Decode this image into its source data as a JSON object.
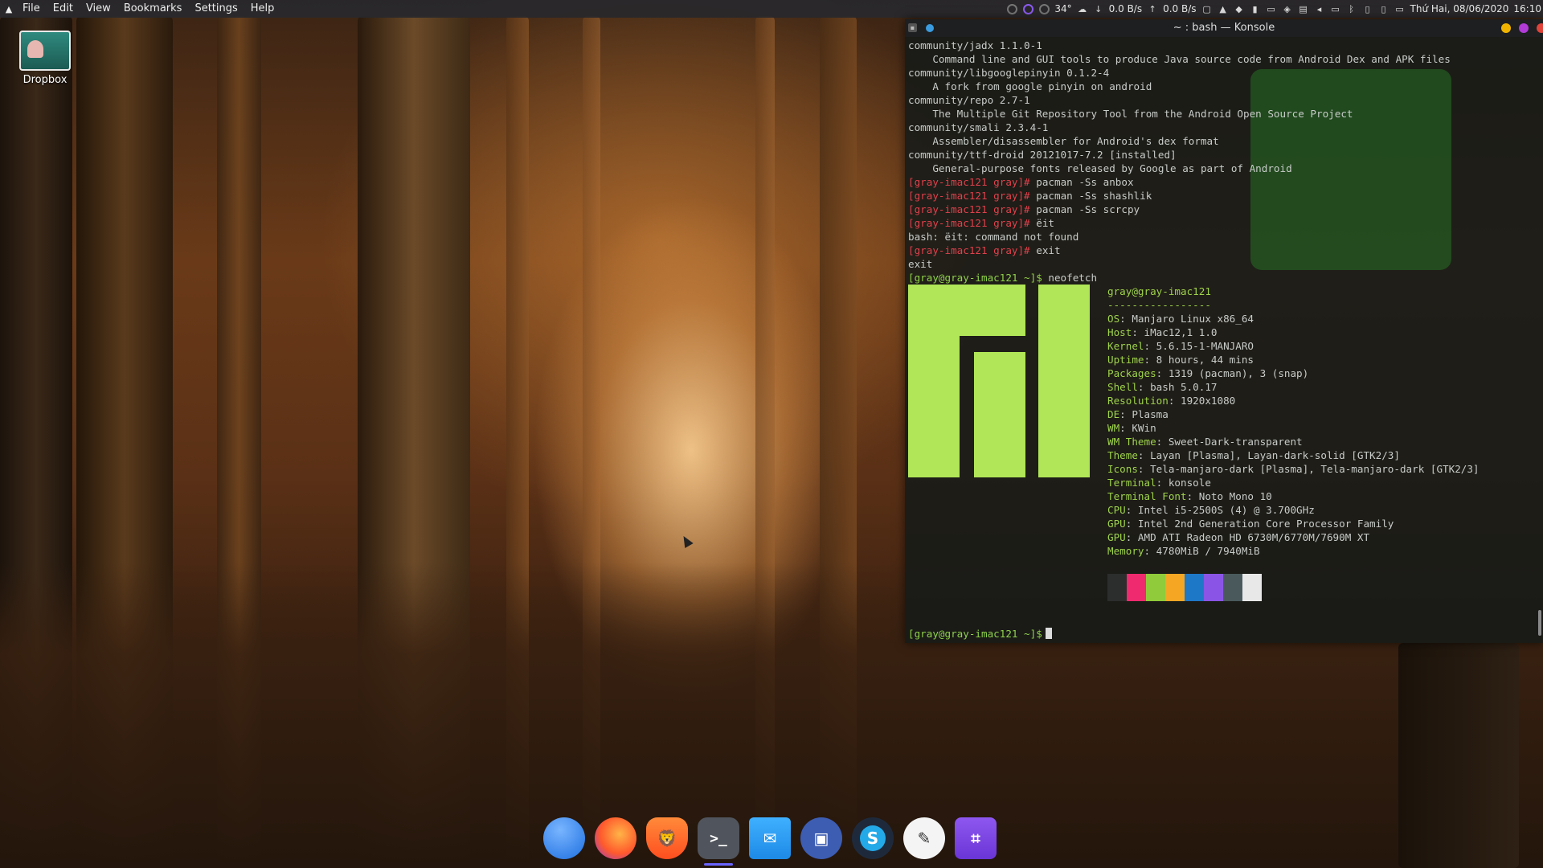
{
  "menu": {
    "items": [
      "File",
      "Edit",
      "View",
      "Bookmarks",
      "Settings",
      "Help"
    ]
  },
  "tray": {
    "temperature": "34°",
    "net_down": "0.0 B/s",
    "net_up": "0.0 B/s",
    "datetime": "Thứ Hai, 08/06/2020",
    "time": "16:10"
  },
  "desktop": {
    "icons": [
      {
        "label": "Dropbox"
      }
    ]
  },
  "konsole": {
    "title": "~ : bash — Konsole",
    "lines": [
      {
        "t": "community/jadx 1.1.0-1"
      },
      {
        "t": "    Command line and GUI tools to produce Java source code from Android Dex and APK files"
      },
      {
        "t": "community/libgooglepinyin 0.1.2-4"
      },
      {
        "t": "    A fork from google pinyin on android"
      },
      {
        "t": "community/repo 2.7-1"
      },
      {
        "t": "    The Multiple Git Repository Tool from the Android Open Source Project"
      },
      {
        "t": "community/smali 2.3.4-1"
      },
      {
        "t": "    Assembler/disassembler for Android's dex format"
      },
      {
        "t": "community/ttf-droid 20121017-7.2 [installed]"
      },
      {
        "t": "    General-purpose fonts released by Google as part of Android"
      },
      {
        "p": "[gray-imac121 gray]#",
        "t": " pacman -Ss anbox"
      },
      {
        "p": "[gray-imac121 gray]#",
        "t": " pacman -Ss shashlik"
      },
      {
        "p": "[gray-imac121 gray]#",
        "t": " pacman -Ss scrcpy"
      },
      {
        "p": "[gray-imac121 gray]#",
        "t": " ëit"
      },
      {
        "t": "bash: ëit: command not found"
      },
      {
        "p": "[gray-imac121 gray]#",
        "t": " exit"
      },
      {
        "t": "exit"
      },
      {
        "g": "[gray@gray-imac121 ~]$",
        "t": " neofetch"
      }
    ],
    "neofetch": {
      "user": "gray@gray-imac121",
      "separator": "-----------------",
      "fields": [
        {
          "k": "OS",
          "v": "Manjaro Linux x86_64"
        },
        {
          "k": "Host",
          "v": "iMac12,1 1.0"
        },
        {
          "k": "Kernel",
          "v": "5.6.15-1-MANJARO"
        },
        {
          "k": "Uptime",
          "v": "8 hours, 44 mins"
        },
        {
          "k": "Packages",
          "v": "1319 (pacman), 3 (snap)"
        },
        {
          "k": "Shell",
          "v": "bash 5.0.17"
        },
        {
          "k": "Resolution",
          "v": "1920x1080"
        },
        {
          "k": "DE",
          "v": "Plasma"
        },
        {
          "k": "WM",
          "v": "KWin"
        },
        {
          "k": "WM Theme",
          "v": "Sweet-Dark-transparent"
        },
        {
          "k": "Theme",
          "v": "Layan [Plasma], Layan-dark-solid [GTK2/3]"
        },
        {
          "k": "Icons",
          "v": "Tela-manjaro-dark [Plasma], Tela-manjaro-dark [GTK2/3]"
        },
        {
          "k": "Terminal",
          "v": "konsole"
        },
        {
          "k": "Terminal Font",
          "v": "Noto Mono 10"
        },
        {
          "k": "CPU",
          "v": "Intel i5-2500S (4) @ 3.700GHz"
        },
        {
          "k": "GPU",
          "v": "Intel 2nd Generation Core Processor Family"
        },
        {
          "k": "GPU",
          "v": "AMD ATI Radeon HD 6730M/6770M/7690M XT"
        },
        {
          "k": "Memory",
          "v": "4780MiB / 7940MiB"
        }
      ],
      "palette": [
        "#2b2e2c",
        "#f02a6e",
        "#8fcb3a",
        "#f5a623",
        "#1e78c8",
        "#8a55e6",
        "#4a5a5c",
        "#e8e8e8"
      ]
    },
    "final_prompt": "[gray@gray-imac121 ~]$"
  },
  "dock": {
    "items": [
      {
        "name": "files",
        "icon": "files-icon"
      },
      {
        "name": "firefox",
        "icon": "firefox-icon"
      },
      {
        "name": "brave",
        "icon": "brave-icon"
      },
      {
        "name": "konsole",
        "icon": "terminal-icon",
        "glyph": ">_",
        "active": true
      },
      {
        "name": "mail",
        "icon": "mail-icon"
      },
      {
        "name": "remote-desktop",
        "icon": "remote-desktop-icon"
      },
      {
        "name": "skype",
        "icon": "skype-icon",
        "glyph": "S"
      },
      {
        "name": "krita",
        "icon": "krita-icon"
      },
      {
        "name": "screenshot",
        "icon": "crop-icon"
      }
    ]
  }
}
